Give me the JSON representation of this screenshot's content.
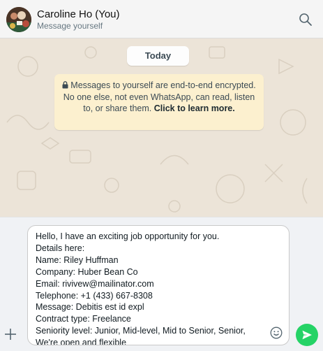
{
  "header": {
    "contact_name": "Caroline Ho",
    "contact_suffix": "(You)",
    "subtitle": "Message yourself",
    "avatar_icon": "avatar-photo",
    "search_icon": "search-icon"
  },
  "chat": {
    "date_label": "Today",
    "encryption_notice": {
      "text": "Messages to yourself are end-to-end encrypted. No one else, not even WhatsApp, can read, listen to, or share them.",
      "link_text": "Click to learn more.",
      "icon": "lock-icon"
    }
  },
  "composer": {
    "draft_text": "Hello, I have an exciting job opportunity for you.\nDetails here:\nName: Riley Huffman\nCompany: Huber Bean Co\nEmail: rivivew@mailinator.com\nTelephone: +1 (433) 667-8308\nMessage: Debitis est id expl\nContract type: Freelance\nSeniority level: Junior, Mid-level, Mid to Senior, Senior,\nWe're open and flexible",
    "attach_icon": "plus-icon",
    "emoji_icon": "emoji-icon",
    "send_icon": "send-icon"
  },
  "colors": {
    "accent": "#25d366",
    "notice_bg": "#fcf0cf",
    "chat_bg": "#ece4d8"
  }
}
